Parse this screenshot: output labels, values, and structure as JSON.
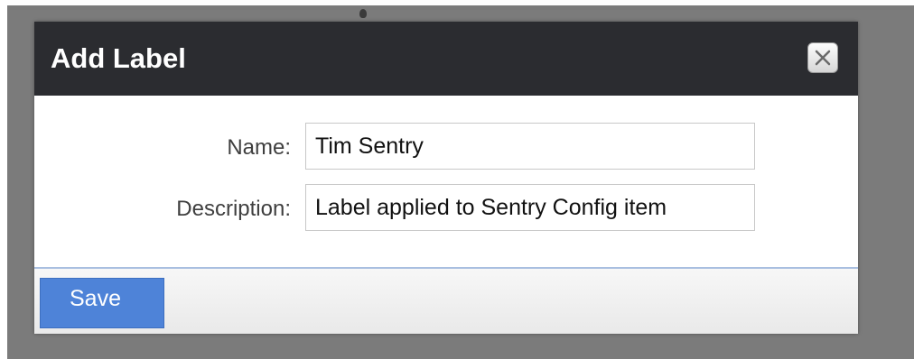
{
  "dialog": {
    "title": "Add Label",
    "close_icon": "close-icon"
  },
  "form": {
    "name_label": "Name:",
    "name_value": "Tim Sentry",
    "description_label": "Description:",
    "description_value": "Label applied to Sentry Config item"
  },
  "footer": {
    "save_label": "Save"
  },
  "colors": {
    "titlebar": "#2b2c30",
    "save_button": "#4e83d8",
    "backdrop": "#7b7b7b",
    "divider": "#a9bfe0"
  }
}
